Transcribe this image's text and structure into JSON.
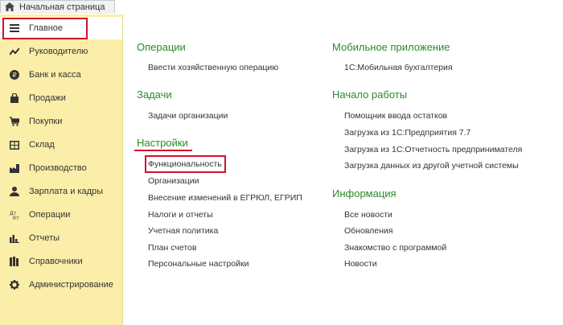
{
  "tab": {
    "home_label": "Начальная страница",
    "icon": "home-icon"
  },
  "sidebar": {
    "items": [
      {
        "label": "Главное",
        "icon": "menu-icon"
      },
      {
        "label": "Руководителю",
        "icon": "chart-line-icon"
      },
      {
        "label": "Банк и касса",
        "icon": "ruble-icon"
      },
      {
        "label": "Продажи",
        "icon": "bag-icon"
      },
      {
        "label": "Покупки",
        "icon": "cart-icon"
      },
      {
        "label": "Склад",
        "icon": "warehouse-icon"
      },
      {
        "label": "Производство",
        "icon": "factory-icon"
      },
      {
        "label": "Зарплата и кадры",
        "icon": "person-icon"
      },
      {
        "label": "Операции",
        "icon": "dt-kt-icon"
      },
      {
        "label": "Отчеты",
        "icon": "bar-chart-icon"
      },
      {
        "label": "Справочники",
        "icon": "books-icon"
      },
      {
        "label": "Администрирование",
        "icon": "gear-icon"
      }
    ]
  },
  "sections": {
    "operations": {
      "title": "Операции",
      "links": [
        "Ввести хозяйственную операцию"
      ]
    },
    "tasks": {
      "title": "Задачи",
      "links": [
        "Задачи организации"
      ]
    },
    "settings": {
      "title": "Настройки",
      "links": [
        "Функциональность",
        "Организации",
        "Внесение изменений в ЕГРЮЛ, ЕГРИП",
        "Налоги и отчеты",
        "Учетная политика",
        "План счетов",
        "Персональные настройки"
      ]
    },
    "mobile": {
      "title": "Мобильное приложение",
      "links": [
        "1С:Мобильная бухгалтерия"
      ]
    },
    "start": {
      "title": "Начало работы",
      "links": [
        "Помощник ввода остатков",
        "Загрузка из 1С:Предприятия 7.7",
        "Загрузка из 1С:Отчетность предпринимателя",
        "Загрузка данных из другой учетной системы"
      ]
    },
    "info": {
      "title": "Информация",
      "links": [
        "Все новости",
        "Обновления",
        "Знакомство с программой",
        "Новости"
      ]
    }
  },
  "colors": {
    "sidebar_bg": "#fbeea8",
    "section_title": "#2a8a2a",
    "highlight": "#d0112b"
  }
}
